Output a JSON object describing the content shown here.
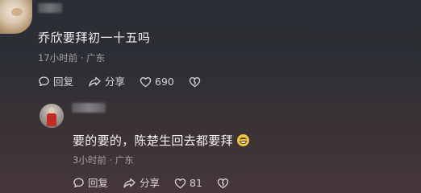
{
  "top_comment": {
    "text": "乔欣要拜初一十五吗",
    "meta": "17小时前 · 广东",
    "actions": {
      "reply": "回复",
      "share": "分享",
      "likes": "690"
    }
  },
  "reply_comment": {
    "text": "要的要的，陈楚生回去都要拜",
    "meta": "3小时前 · 广东",
    "actions": {
      "reply": "回复",
      "share": "分享",
      "likes": "81"
    }
  },
  "icons": {
    "reply": "comment-bubble-icon",
    "share": "share-arrow-icon",
    "like": "heart-icon",
    "dislike": "broken-heart-icon",
    "emoji": "grinning-face-emoji"
  },
  "colors": {
    "text_primary": "#f5f2f1",
    "text_secondary": "#a3a0a3",
    "action_text": "#d7d3d3",
    "background_top": "#2a2d34",
    "background_bottom": "#46373a"
  }
}
